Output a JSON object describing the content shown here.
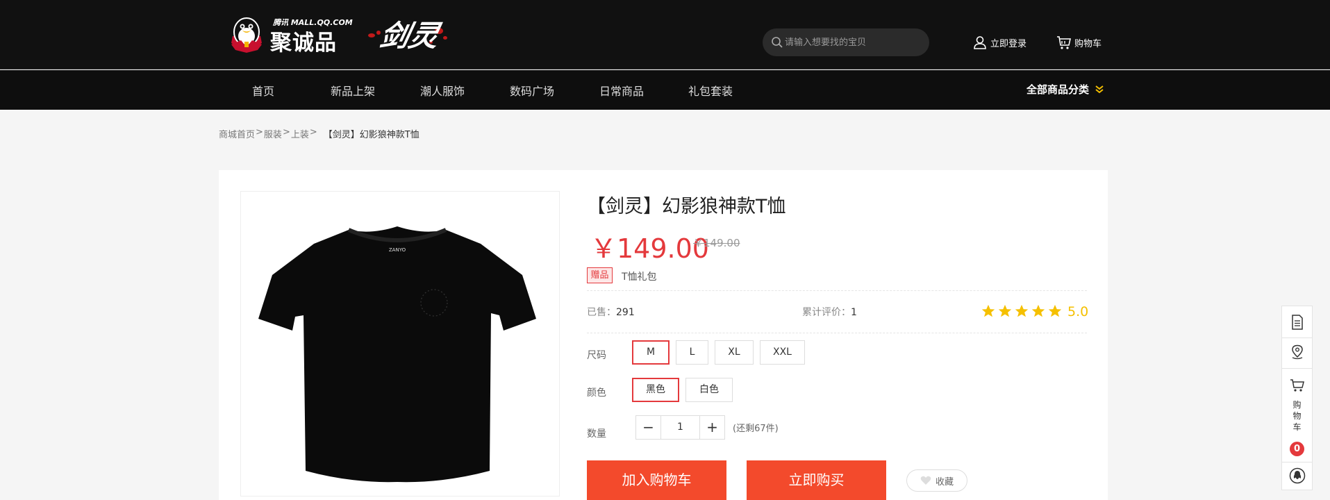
{
  "header": {
    "brand_sub": "腾讯 MALL.QQ.COM",
    "brand_main": "聚诚品",
    "game_logo_text": "剑灵",
    "search": {
      "placeholder": "请输入想要找的宝贝"
    },
    "login_label": "立即登录",
    "cart_label": "购物车"
  },
  "nav": {
    "items": [
      {
        "label": "首页"
      },
      {
        "label": "新品上架"
      },
      {
        "label": "潮人服饰"
      },
      {
        "label": "数码广场"
      },
      {
        "label": "日常商品"
      },
      {
        "label": "礼包套装"
      }
    ],
    "all_categories": "全部商品分类"
  },
  "breadcrumb": {
    "items": [
      "商城首页",
      "服装",
      "上装"
    ],
    "separator": ">",
    "current": "【剑灵】幻影狼神款T恤"
  },
  "product": {
    "title": "【剑灵】幻影狼神款T恤",
    "price": "￥149.00",
    "original_price": "￥149.00",
    "gift_tag": "赠品",
    "gift_text": "T恤礼包",
    "sold_label": "已售：",
    "sold_value": "291",
    "reviews_label": "累计评价：",
    "reviews_value": "1",
    "rating": "5.0",
    "stars": 5,
    "shirt_print": "ZANYO",
    "size_label": "尺码",
    "sizes": [
      "M",
      "L",
      "XL",
      "XXL"
    ],
    "selected_size": "M",
    "color_label": "颜色",
    "colors": [
      "黑色",
      "白色"
    ],
    "selected_color": "黑色",
    "quantity_label": "数量",
    "quantity": "1",
    "minus": "−",
    "plus": "+",
    "stock_text": "(还剩67件)",
    "add_to_cart": "加入购物车",
    "buy_now": "立即购买",
    "favorite": "收藏"
  },
  "sidebar": {
    "cart_text": "购物车",
    "cart_count": "0"
  },
  "colors": {
    "accent": "#f34a2c",
    "price": "#e4393c",
    "star": "#f5c000",
    "header_bg": "#111111"
  }
}
